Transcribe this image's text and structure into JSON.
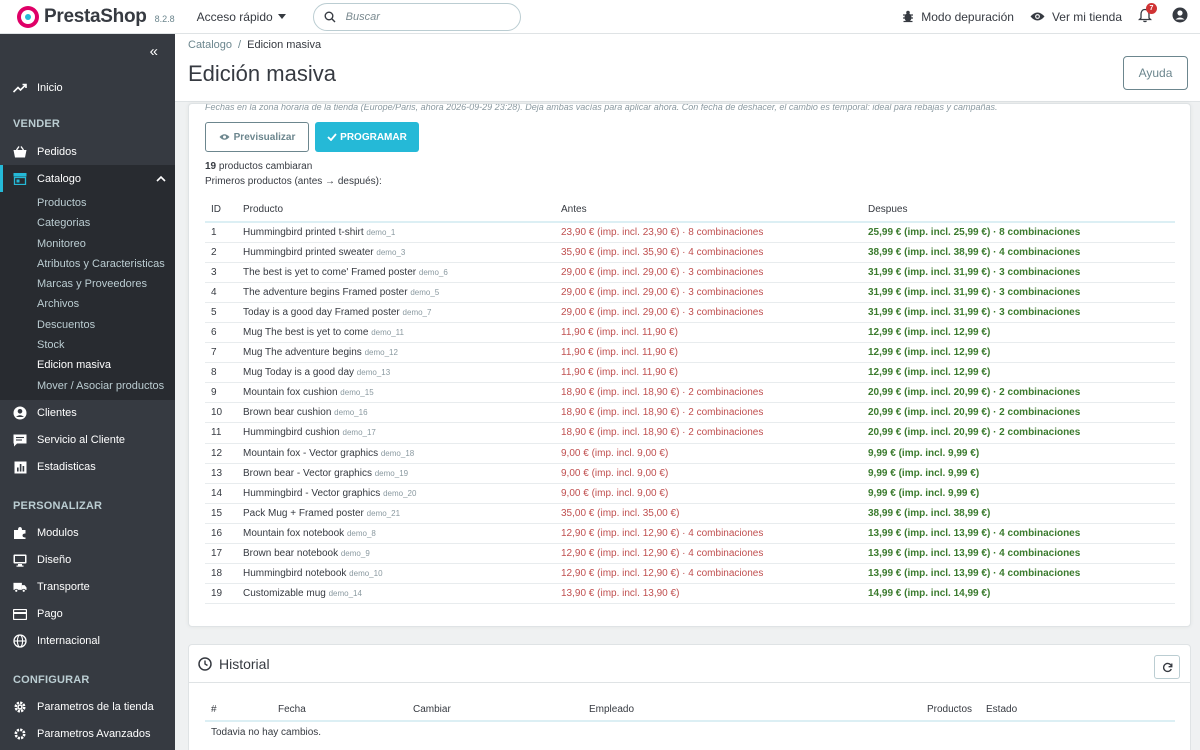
{
  "header": {
    "brand": "PrestaShop",
    "version": "8.2.8",
    "quick_access": "Acceso rápido",
    "search_placeholder": "Buscar",
    "debug_mode": "Modo depuración",
    "view_store": "Ver mi tienda",
    "notifications_count": "7"
  },
  "sidebar": {
    "inicio": "Inicio",
    "section_vender": "VENDER",
    "pedidos": "Pedidos",
    "catalogo": "Catalogo",
    "catalog_sub": [
      "Productos",
      "Categorias",
      "Monitoreo",
      "Atributos y Caracteristicas",
      "Marcas y Proveedores",
      "Archivos",
      "Descuentos",
      "Stock",
      "Edicion masiva",
      "Mover / Asociar productos"
    ],
    "clientes": "Clientes",
    "servicio": "Servicio al Cliente",
    "estadisticas": "Estadisticas",
    "section_personalizar": "PERSONALIZAR",
    "modulos": "Modulos",
    "diseno": "Diseño",
    "transporte": "Transporte",
    "pago": "Pago",
    "internacional": "Internacional",
    "section_configurar": "CONFIGURAR",
    "parametros_tienda": "Parametros de la tienda",
    "parametros_avanzados": "Parametros Avanzados"
  },
  "page": {
    "breadcrumb_parent": "Catalogo",
    "breadcrumb_current": "Edicion masiva",
    "title": "Edición masiva",
    "help": "Ayuda"
  },
  "panel": {
    "note": "Fechas en la zona horaria de la tienda (Europe/Paris, ahora 2026-09-29 23:28). Deja ambas vacías para aplicar ahora. Con fecha de deshacer, el cambio es temporal: ideal para rebajas y campañas.",
    "preview_button": "Previsualizar",
    "schedule_button": "PROGRAMAR",
    "count_number": "19",
    "count_text": " productos cambiaran",
    "first_products": "Primeros productos (antes → después):",
    "columns": [
      "ID",
      "Producto",
      "Antes",
      "Despues"
    ],
    "rows": [
      {
        "id": "1",
        "name": "Hummingbird printed t-shirt",
        "ref": "demo_1",
        "before": "23,90 € (imp. incl. 23,90 €) · 8 combinaciones",
        "after": "25,99 € (imp. incl. 25,99 €) · 8 combinaciones"
      },
      {
        "id": "2",
        "name": "Hummingbird printed sweater",
        "ref": "demo_3",
        "before": "35,90 € (imp. incl. 35,90 €) · 4 combinaciones",
        "after": "38,99 € (imp. incl. 38,99 €) · 4 combinaciones"
      },
      {
        "id": "3",
        "name": "The best is yet to come' Framed poster",
        "ref": "demo_6",
        "before": "29,00 € (imp. incl. 29,00 €) · 3 combinaciones",
        "after": "31,99 € (imp. incl. 31,99 €) · 3 combinaciones"
      },
      {
        "id": "4",
        "name": "The adventure begins Framed poster",
        "ref": "demo_5",
        "before": "29,00 € (imp. incl. 29,00 €) · 3 combinaciones",
        "after": "31,99 € (imp. incl. 31,99 €) · 3 combinaciones"
      },
      {
        "id": "5",
        "name": "Today is a good day Framed poster",
        "ref": "demo_7",
        "before": "29,00 € (imp. incl. 29,00 €) · 3 combinaciones",
        "after": "31,99 € (imp. incl. 31,99 €) · 3 combinaciones"
      },
      {
        "id": "6",
        "name": "Mug The best is yet to come",
        "ref": "demo_11",
        "before": "11,90 € (imp. incl. 11,90 €)",
        "after": "12,99 € (imp. incl. 12,99 €)"
      },
      {
        "id": "7",
        "name": "Mug The adventure begins",
        "ref": "demo_12",
        "before": "11,90 € (imp. incl. 11,90 €)",
        "after": "12,99 € (imp. incl. 12,99 €)"
      },
      {
        "id": "8",
        "name": "Mug Today is a good day",
        "ref": "demo_13",
        "before": "11,90 € (imp. incl. 11,90 €)",
        "after": "12,99 € (imp. incl. 12,99 €)"
      },
      {
        "id": "9",
        "name": "Mountain fox cushion",
        "ref": "demo_15",
        "before": "18,90 € (imp. incl. 18,90 €) · 2 combinaciones",
        "after": "20,99 € (imp. incl. 20,99 €) · 2 combinaciones"
      },
      {
        "id": "10",
        "name": "Brown bear cushion",
        "ref": "demo_16",
        "before": "18,90 € (imp. incl. 18,90 €) · 2 combinaciones",
        "after": "20,99 € (imp. incl. 20,99 €) · 2 combinaciones"
      },
      {
        "id": "11",
        "name": "Hummingbird cushion",
        "ref": "demo_17",
        "before": "18,90 € (imp. incl. 18,90 €) · 2 combinaciones",
        "after": "20,99 € (imp. incl. 20,99 €) · 2 combinaciones"
      },
      {
        "id": "12",
        "name": "Mountain fox - Vector graphics",
        "ref": "demo_18",
        "before": "9,00 € (imp. incl. 9,00 €)",
        "after": "9,99 € (imp. incl. 9,99 €)"
      },
      {
        "id": "13",
        "name": "Brown bear - Vector graphics",
        "ref": "demo_19",
        "before": "9,00 € (imp. incl. 9,00 €)",
        "after": "9,99 € (imp. incl. 9,99 €)"
      },
      {
        "id": "14",
        "name": "Hummingbird - Vector graphics",
        "ref": "demo_20",
        "before": "9,00 € (imp. incl. 9,00 €)",
        "after": "9,99 € (imp. incl. 9,99 €)"
      },
      {
        "id": "15",
        "name": "Pack Mug + Framed poster",
        "ref": "demo_21",
        "before": "35,00 € (imp. incl. 35,00 €)",
        "after": "38,99 € (imp. incl. 38,99 €)"
      },
      {
        "id": "16",
        "name": "Mountain fox notebook",
        "ref": "demo_8",
        "before": "12,90 € (imp. incl. 12,90 €) · 4 combinaciones",
        "after": "13,99 € (imp. incl. 13,99 €) · 4 combinaciones"
      },
      {
        "id": "17",
        "name": "Brown bear notebook",
        "ref": "demo_9",
        "before": "12,90 € (imp. incl. 12,90 €) · 4 combinaciones",
        "after": "13,99 € (imp. incl. 13,99 €) · 4 combinaciones"
      },
      {
        "id": "18",
        "name": "Hummingbird notebook",
        "ref": "demo_10",
        "before": "12,90 € (imp. incl. 12,90 €) · 4 combinaciones",
        "after": "13,99 € (imp. incl. 13,99 €) · 4 combinaciones"
      },
      {
        "id": "19",
        "name": "Customizable mug",
        "ref": "demo_14",
        "before": "13,90 € (imp. incl. 13,90 €)",
        "after": "14,99 € (imp. incl. 14,99 €)"
      }
    ]
  },
  "history": {
    "title": "Historial",
    "columns": [
      "#",
      "Fecha",
      "Cambiar",
      "Empleado",
      "Productos",
      "Estado"
    ],
    "empty": "Todavia no hay cambios."
  },
  "colors": {
    "accent": "#25b9d7",
    "sidebar_bg": "#363a41",
    "price_before": "#c05050",
    "price_after": "#3b7b2e",
    "brand": "#df0067"
  }
}
